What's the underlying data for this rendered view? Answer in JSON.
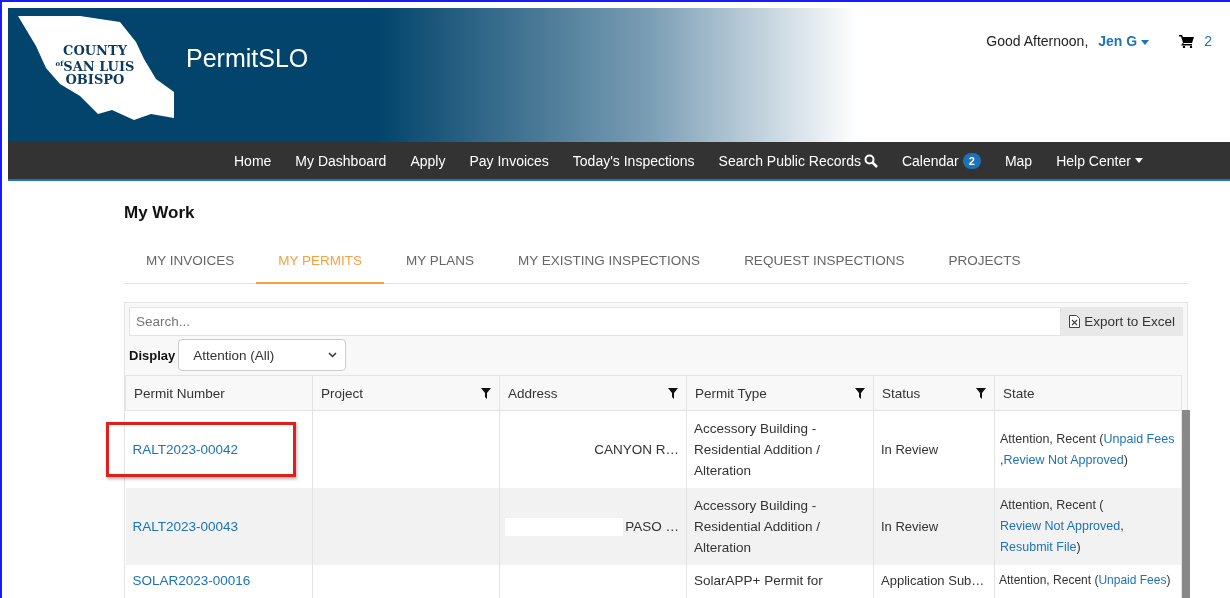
{
  "header": {
    "logo": {
      "lines": [
        "COUNTY",
        "$^{of}$SAN LUIS",
        "OBISPO"
      ]
    },
    "title": "PermitSLO",
    "greeting": "Good Afternoon,",
    "user": "Jen G",
    "cart_count": "2"
  },
  "nav": [
    {
      "label": "Home",
      "kind": "plain"
    },
    {
      "label": "My Dashboard",
      "kind": "plain"
    },
    {
      "label": "Apply",
      "kind": "plain"
    },
    {
      "label": "Pay Invoices",
      "kind": "plain"
    },
    {
      "label": "Today's Inspections",
      "kind": "plain"
    },
    {
      "label": "Search Public Records",
      "kind": "search"
    },
    {
      "label": "Calendar",
      "kind": "badge",
      "badge": "2"
    },
    {
      "label": "Map",
      "kind": "plain"
    },
    {
      "label": "Help Center",
      "kind": "dropdown"
    }
  ],
  "page_title": "My Work",
  "tabs": [
    {
      "label": "MY INVOICES",
      "selected": false
    },
    {
      "label": "MY PERMITS",
      "selected": true
    },
    {
      "label": "MY PLANS",
      "selected": false
    },
    {
      "label": "MY EXISTING INSPECTIONS",
      "selected": false
    },
    {
      "label": "REQUEST INSPECTIONS",
      "selected": false
    },
    {
      "label": "PROJECTS",
      "selected": false
    }
  ],
  "search": {
    "placeholder": "Search..."
  },
  "export_button": "Export to Excel",
  "display": {
    "label": "Display",
    "value": "Attention (All)"
  },
  "table": {
    "columns": [
      {
        "label": "Permit Number",
        "filter": false
      },
      {
        "label": "Project",
        "filter": true
      },
      {
        "label": "Address",
        "filter": true
      },
      {
        "label": "Permit Type",
        "filter": true
      },
      {
        "label": "Status",
        "filter": true
      },
      {
        "label": "State",
        "filter": false
      }
    ],
    "rows": [
      {
        "permit": "RALT2023-00042",
        "highlighted": true,
        "address": "CANYON R…",
        "redacted": false,
        "type": "Accessory Building - Residential Addition / Alteration",
        "status": "In Review",
        "state": [
          {
            "text": "Attention, Recent ("
          },
          {
            "link": "Unpaid Fees"
          },
          {
            "text": ","
          },
          {
            "link": "Review Not Approved"
          },
          {
            "text": ")"
          }
        ]
      },
      {
        "permit": "RALT2023-00043",
        "highlighted": false,
        "address": "PASO …",
        "redacted": true,
        "type": "Accessory Building - Residential Addition / Alteration",
        "status": "In Review",
        "state": [
          {
            "text": "Attention, Recent ("
          },
          {
            "link": "Review Not Approved"
          },
          {
            "text": ", "
          },
          {
            "link": "Resubmit File"
          },
          {
            "text": ")"
          }
        ]
      },
      {
        "permit": "SOLAR2023-00016",
        "highlighted": false,
        "redacted": false,
        "type": "SolarAPP+ Permit for",
        "status": "Application Sub…",
        "state": [
          {
            "text": "Attention, Recent ("
          },
          {
            "link": "Unpaid Fees"
          },
          {
            "text": ")"
          }
        ]
      }
    ]
  }
}
